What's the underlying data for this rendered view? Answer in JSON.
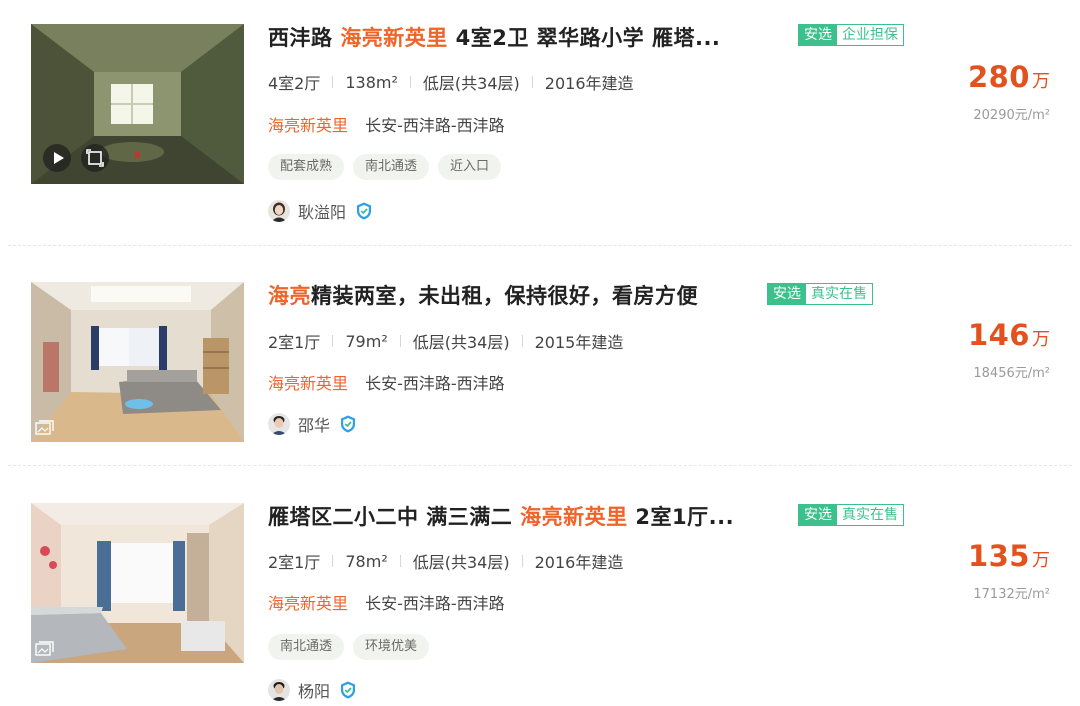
{
  "listings": [
    {
      "title_parts": [
        "西沣路 ",
        "海亮新英里",
        " 4室2卫 翠华路小学 雁塔..."
      ],
      "badge": [
        "安选",
        "企业担保"
      ],
      "meta": [
        "4室2厅",
        "138m²",
        "低层(共34层)",
        "2016年建造"
      ],
      "community": "海亮新英里",
      "district": "长安-西沣路-西沣路",
      "tags": [
        "配套成熟",
        "南北通透",
        "近入口"
      ],
      "agent": "耿溢阳",
      "price": "280",
      "price_unit": "万",
      "unit_price": "20290元/m²"
    },
    {
      "title_parts": [
        "",
        "海亮",
        "精装两室，未出租，保持很好，看房方便"
      ],
      "badge": [
        "安选",
        "真实在售"
      ],
      "meta": [
        "2室1厅",
        "79m²",
        "低层(共34层)",
        "2015年建造"
      ],
      "community": "海亮新英里",
      "district": "长安-西沣路-西沣路",
      "tags": [],
      "agent": "邵华",
      "price": "146",
      "price_unit": "万",
      "unit_price": "18456元/m²"
    },
    {
      "title_parts": [
        "雁塔区二小二中 满三满二 ",
        "海亮新英里",
        " 2室1厅..."
      ],
      "badge": [
        "安选",
        "真实在售"
      ],
      "meta": [
        "2室1厅",
        "78m²",
        "低层(共34层)",
        "2016年建造"
      ],
      "community": "海亮新英里",
      "district": "长安-西沣路-西沣路",
      "tags": [
        "南北通透",
        "环境优美"
      ],
      "agent": "杨阳",
      "price": "135",
      "price_unit": "万",
      "unit_price": "17132元/m²"
    }
  ],
  "icons": {
    "play": "play-icon",
    "vr": "vr-view-icon",
    "gallery": "gallery-icon",
    "verified": "shield-check-icon"
  },
  "colors": {
    "highlight": "#f0642a",
    "price": "#e3521e",
    "badge_green": "#3cc18d"
  }
}
